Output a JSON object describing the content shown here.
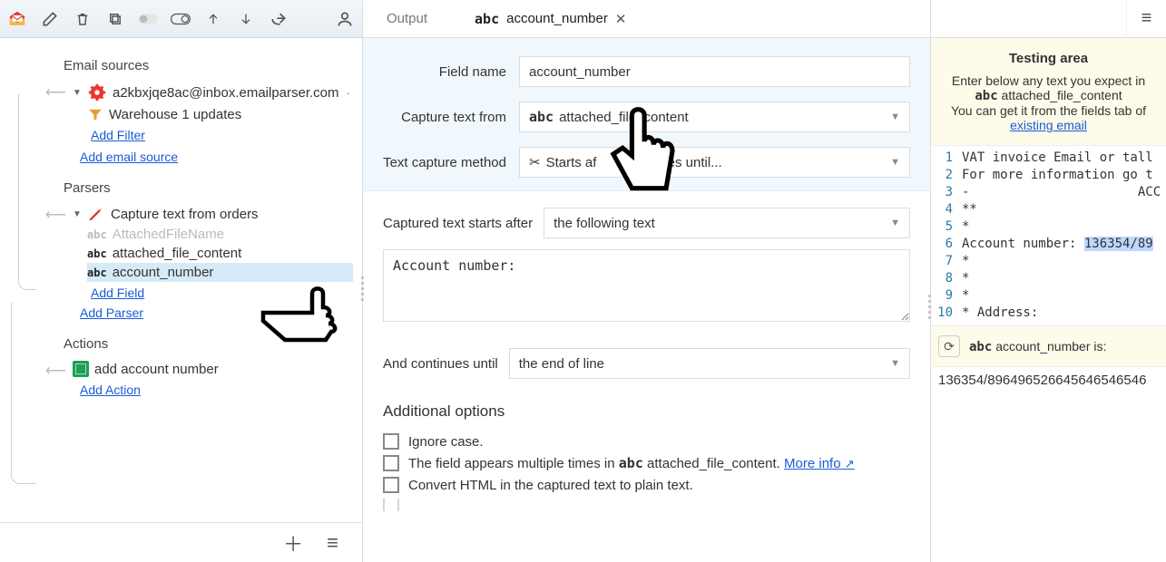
{
  "sidebar": {
    "sections": {
      "email_sources": {
        "title": "Email sources"
      },
      "parsers": {
        "title": "Parsers"
      },
      "actions": {
        "title": "Actions"
      }
    },
    "email_sources": {
      "account": "a2kbxjqe8ac@inbox.emailparser.com",
      "sub1": "Warehouse 1 updates",
      "add_filter": "Add Filter",
      "add_email_source": "Add email source"
    },
    "parsers": {
      "root": "Capture text from orders",
      "f1": "AttachedFileName",
      "f2": "attached_file_content",
      "f3": "account_number",
      "add_field": "Add Field",
      "add_parser": "Add Parser"
    },
    "actions": {
      "a1": "add account number",
      "add_action": "Add Action"
    }
  },
  "tabs": {
    "output": "Output",
    "active_field": "account_number"
  },
  "form": {
    "field_name_label": "Field name",
    "field_name_value": "account_number",
    "capture_from_label": "Capture text from",
    "capture_from_value": "attached_file_content",
    "method_label": "Text capture method",
    "method_value_prefix": "Starts af",
    "method_value_suffix": "tinues until..."
  },
  "body": {
    "starts_after_label": "Captured text starts after",
    "starts_after_select": "the following text",
    "starts_after_textarea": "Account number:",
    "continues_label": "And continues until",
    "continues_select": "the end of line",
    "additional_title": "Additional options",
    "opt_ignore": "Ignore case.",
    "opt_multi_pre": "The field appears multiple times in ",
    "opt_multi_field": "attached_file_content",
    "opt_multi_post": ". ",
    "more_info": "More info",
    "opt_html": "Convert HTML in the captured text to plain text."
  },
  "testing": {
    "title": "Testing area",
    "desc1": "Enter below any text you expect in",
    "desc_field": "attached_file_content",
    "desc2": "You can get it from the fields tab of",
    "link": "existing email",
    "code_lines": [
      "VAT invoice Email or tall",
      "For more information go t",
      "-                      ACC",
      "**",
      "*",
      "Account number: 136354/89",
      "*",
      "*",
      "*",
      "* Address:"
    ],
    "result_label_field": "account_number",
    "result_label_suffix": " is:",
    "result_value": "136354/89649652664564654­6546"
  },
  "abc": "abc"
}
